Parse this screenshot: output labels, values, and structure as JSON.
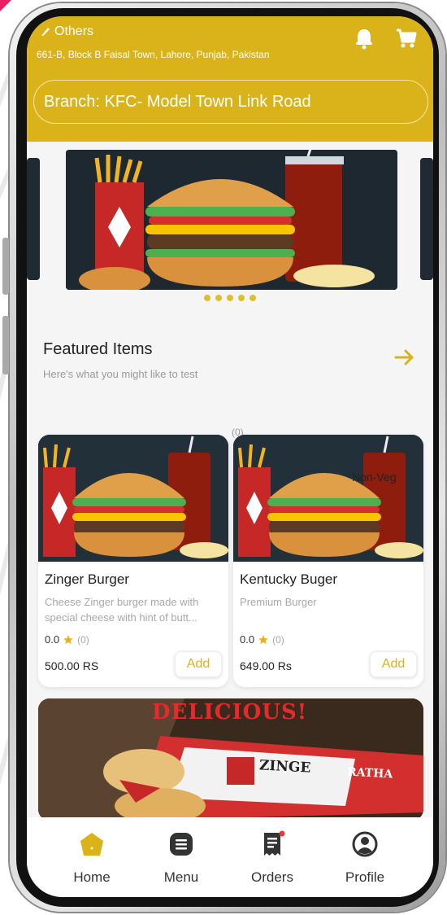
{
  "header": {
    "location_title": "Others",
    "address": "661-B, Block B Faisal Town, Lahore, Punjab, Pakistan",
    "branch": "Branch: KFC- Model Town Link Road",
    "icons": [
      "location-icon",
      "bell-icon",
      "cart-icon"
    ]
  },
  "carousel": {
    "slide_count": 5,
    "active_index": 0
  },
  "featured": {
    "title": "Featured Items",
    "subtitle": "Here's what you might like to test",
    "top_count": "(0)"
  },
  "products": [
    {
      "name": "Zinger Burger",
      "description": "Cheese Zinger burger made with special cheese with hint of butt...",
      "rating": "0.0",
      "rating_count": "(0)",
      "price": "500.00 RS",
      "add_label": "Add",
      "tag": ""
    },
    {
      "name": "Kentucky Buger",
      "description": "Premium Burger",
      "rating": "0.0",
      "rating_count": "(0)",
      "price": "649.00 Rs",
      "add_label": "Add",
      "tag": "Non-Veg"
    }
  ],
  "promo": {
    "headline": "DELICIOUS!",
    "brand": "ZINGE",
    "brand_tail": "RATHA"
  },
  "nav": [
    {
      "label": "Home",
      "icon": "home-icon",
      "active": true
    },
    {
      "label": "Menu",
      "icon": "menu-icon",
      "active": false
    },
    {
      "label": "Orders",
      "icon": "orders-icon",
      "active": false,
      "badge": true
    },
    {
      "label": "Profile",
      "icon": "profile-icon",
      "active": false
    }
  ],
  "colors": {
    "accent": "#d9b319",
    "star": "#e8b21a",
    "badge": "#e53935",
    "promo_red": "#e42a2a"
  }
}
